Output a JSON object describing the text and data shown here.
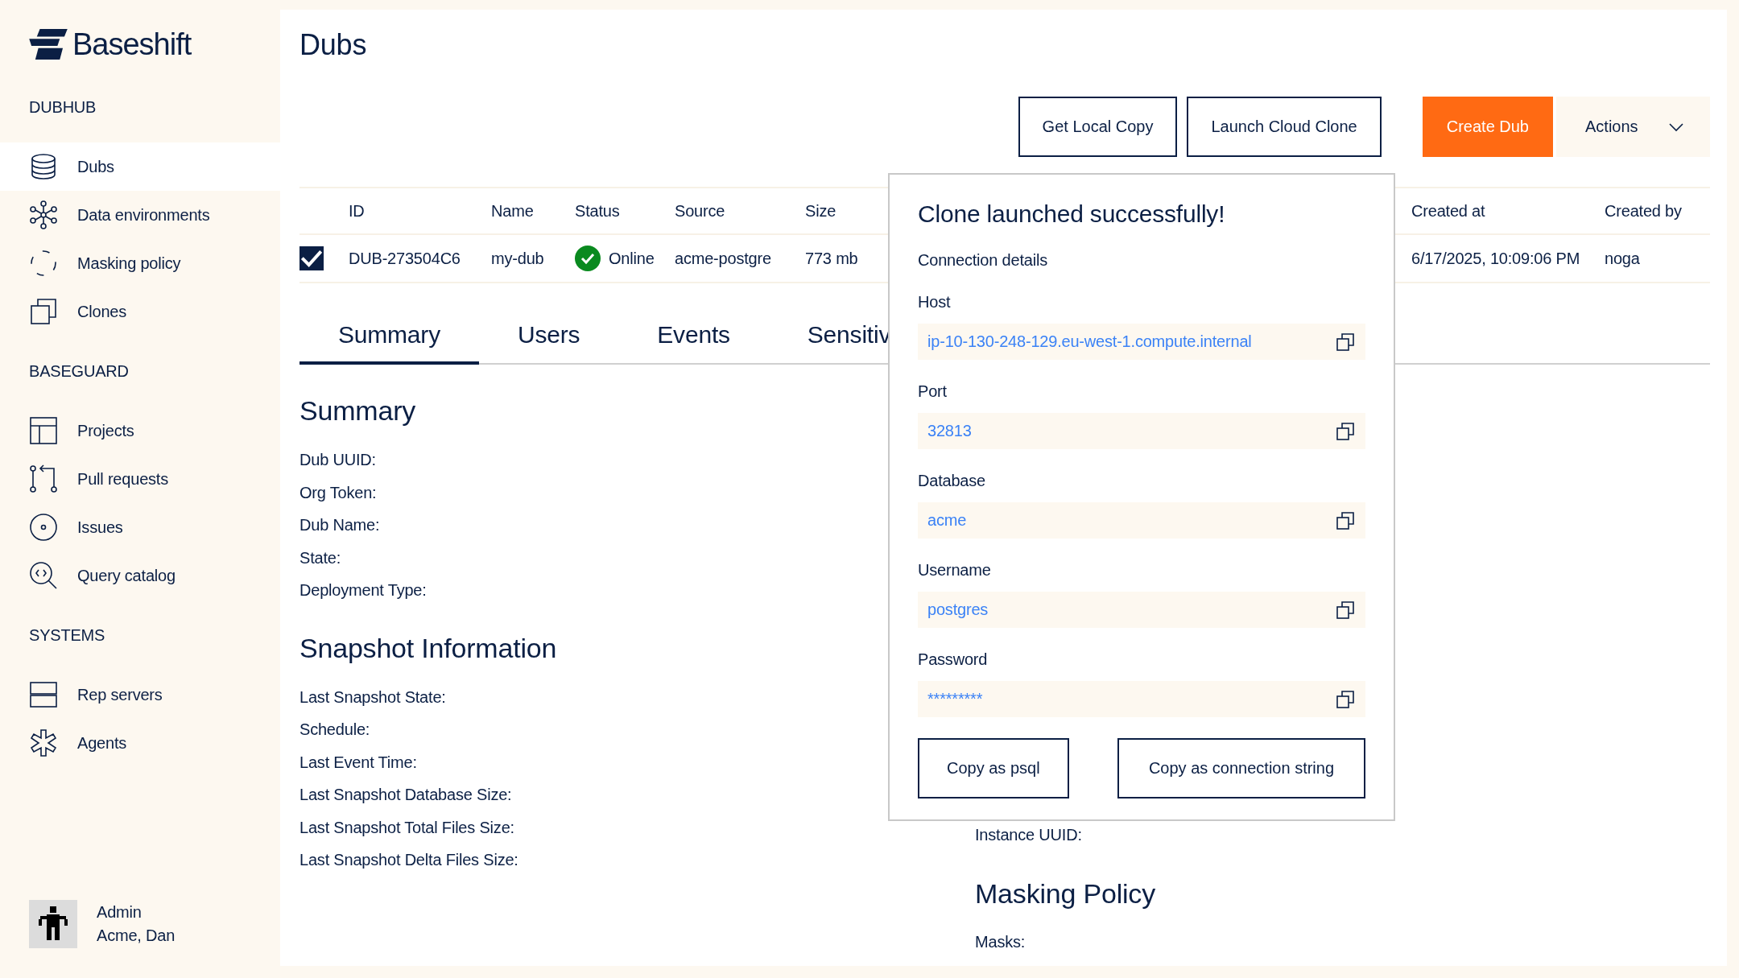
{
  "logo": {
    "text": "Baseshift"
  },
  "sidebar": {
    "sections": [
      {
        "heading": "DUBHUB",
        "items": [
          {
            "label": "Dubs",
            "selected": true
          },
          {
            "label": "Data environments",
            "selected": false
          },
          {
            "label": "Masking policy",
            "selected": false
          },
          {
            "label": "Clones",
            "selected": false
          }
        ]
      },
      {
        "heading": "BASEGUARD",
        "items": [
          {
            "label": "Projects",
            "selected": false
          },
          {
            "label": "Pull requests",
            "selected": false
          },
          {
            "label": "Issues",
            "selected": false
          },
          {
            "label": "Query catalog",
            "selected": false
          }
        ]
      },
      {
        "heading": "SYSTEMS",
        "items": [
          {
            "label": "Rep servers",
            "selected": false
          },
          {
            "label": "Agents",
            "selected": false
          }
        ]
      }
    ],
    "user": {
      "role": "Admin",
      "name": "Acme, Dan"
    }
  },
  "page": {
    "title": "Dubs"
  },
  "toolbar": {
    "buttons": [
      {
        "label": "Get Local Copy",
        "kind": "outline"
      },
      {
        "label": "Launch Cloud Clone",
        "kind": "outline"
      },
      {
        "label": "Create Dub",
        "kind": "primary"
      },
      {
        "label": "Actions",
        "kind": "menu"
      }
    ]
  },
  "table": {
    "columns": [
      "ID",
      "Name",
      "Status",
      "Source",
      "Size",
      "Created at",
      "Created by"
    ],
    "rows": [
      {
        "checked": true,
        "id": "DUB-273504C6",
        "name": "my-dub",
        "status": {
          "text": "Online",
          "kind": "ok"
        },
        "source": "acme-postgre",
        "size": "773 mb",
        "created_at": "6/17/2025, 10:09:06 PM",
        "created_by": "noga"
      }
    ]
  },
  "tabs": [
    {
      "label": "Summary",
      "selected": true
    },
    {
      "label": "Users",
      "selected": false
    },
    {
      "label": "Events",
      "selected": false
    },
    {
      "label": "Sensitiv",
      "selected": false
    }
  ],
  "details": {
    "left": [
      {
        "title": "Summary",
        "fields": [
          "Dub UUID:",
          "Org Token:",
          "Dub Name:",
          "State:",
          "Deployment Type:"
        ]
      },
      {
        "title": "Snapshot Information",
        "fields": [
          "Last Snapshot State:",
          "Schedule:",
          "Last Event Time:",
          "Last Snapshot Database Size:",
          "Last Snapshot Total Files Size:",
          "Last Snapshot Delta Files Size:"
        ]
      }
    ],
    "right": {
      "fields": [
        "Instance UUID:"
      ],
      "sections": [
        {
          "title": "Masking Policy",
          "fields": [
            "Masks:"
          ]
        }
      ]
    }
  },
  "popup": {
    "title": "Clone launched successfully!",
    "subtitle": "Connection details",
    "fields": [
      {
        "label": "Host",
        "value": "ip-10-130-248-129.eu-west-1.compute.internal"
      },
      {
        "label": "Port",
        "value": "32813"
      },
      {
        "label": "Database",
        "value": "acme"
      },
      {
        "label": "Username",
        "value": "postgres"
      },
      {
        "label": "Password",
        "value": "*********"
      }
    ],
    "buttons": [
      "Copy as psql",
      "Copy as connection string"
    ]
  }
}
